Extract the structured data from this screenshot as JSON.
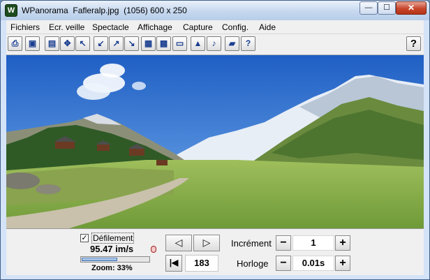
{
  "window": {
    "app_name": "WPanorama",
    "file_name": "Fafleralp.jpg",
    "image_info": "(1056) 600 x 250",
    "controls": {
      "minimize": "—",
      "maximize": "☐",
      "close": "✕"
    }
  },
  "menu": {
    "items": [
      "Fichiers",
      "Ecr. veille",
      "Spectacle",
      "Affichage",
      "Capture",
      "Config.",
      "Aide"
    ]
  },
  "toolbar": {
    "buttons": [
      {
        "icon": "print-icon",
        "glyph": "⎙"
      },
      {
        "icon": "image-icon",
        "glyph": "▣"
      },
      {
        "icon": "page-icon",
        "glyph": "▤"
      },
      {
        "icon": "move-icon",
        "glyph": "✥"
      },
      {
        "icon": "arrow-up-left-icon",
        "glyph": "↖"
      },
      {
        "icon": "arrow-down-left-icon",
        "glyph": "↙"
      },
      {
        "icon": "arrow-up-right-icon",
        "glyph": "↗"
      },
      {
        "icon": "arrow-down-right-icon",
        "glyph": "↘"
      },
      {
        "icon": "screen-fit-icon",
        "glyph": "▦"
      },
      {
        "icon": "screen-full-icon",
        "glyph": "▩"
      },
      {
        "icon": "screen-wide-icon",
        "glyph": "▭"
      },
      {
        "icon": "landscape-icon",
        "glyph": "▲"
      },
      {
        "icon": "sound-icon",
        "glyph": "♪"
      },
      {
        "icon": "book-icon",
        "glyph": "▰"
      },
      {
        "icon": "help-book-icon",
        "glyph": "?"
      }
    ],
    "help_glyph": "?"
  },
  "status": {
    "scroll_checked": true,
    "scroll_check_glyph": "✓",
    "scroll_label": "Défilement",
    "speed": "95.47 im/s",
    "zoom_label": "Zoom: 33%",
    "zoom_level": 0.33,
    "prev_glyph": "◁",
    "next_glyph": "▷",
    "first_glyph": "|◀",
    "frame": "183",
    "increment_label": "Incrément",
    "increment_value": "1",
    "clock_label": "Horloge",
    "clock_value": "0.01s",
    "minus": "−",
    "plus": "+"
  }
}
